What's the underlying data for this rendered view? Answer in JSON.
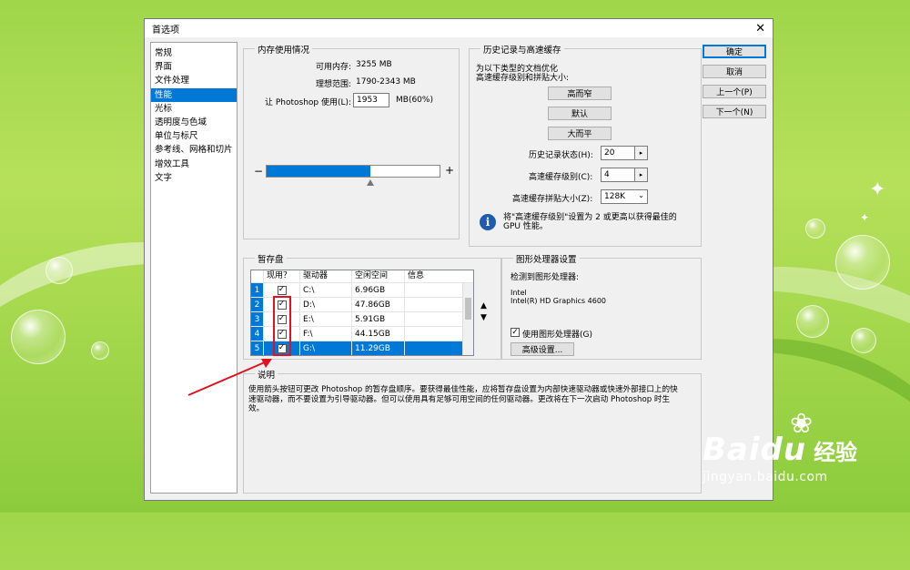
{
  "window": {
    "title": "首选项",
    "close_symbol": "✕"
  },
  "sidebar": {
    "items": [
      {
        "label": "常规"
      },
      {
        "label": "界面"
      },
      {
        "label": "文件处理"
      },
      {
        "label": "性能"
      },
      {
        "label": "光标"
      },
      {
        "label": "透明度与色域"
      },
      {
        "label": "单位与标尺"
      },
      {
        "label": "参考线、网格和切片"
      },
      {
        "label": "增效工具"
      },
      {
        "label": "文字"
      }
    ],
    "selected_index": 3
  },
  "memory": {
    "group_label": "内存使用情况",
    "available_label": "可用内存:",
    "available_value": "3255 MB",
    "ideal_label": "理想范围:",
    "ideal_value": "1790-2343 MB",
    "let_label": "让 Photoshop 使用(L):",
    "let_value": "1953",
    "let_suffix": "MB(60%)",
    "minus": "−",
    "plus": "+",
    "slider_percent": 60
  },
  "history": {
    "group_label": "历史记录与高速缓存",
    "intro_line1": "为以下类型的文档优化",
    "intro_line2": "高速缓存级别和拼贴大小:",
    "btn_tall_thin": "高而窄",
    "btn_default": "默认",
    "btn_big_flat": "大而平",
    "states_label": "历史记录状态(H):",
    "states_value": "20",
    "levels_label": "高速缓存级别(C):",
    "levels_value": "4",
    "tile_label": "高速缓存拼贴大小(Z):",
    "tile_value": "128K",
    "info_text_line1": "将\"高速缓存级别\"设置为 2 或更高以获得最佳的",
    "info_text_line2": "GPU 性能。"
  },
  "scratch": {
    "group_label": "暂存盘",
    "headers": [
      "现用？",
      "驱动器",
      "空闲空间",
      "信息"
    ],
    "rows": [
      {
        "num": "1",
        "drive": "C:\\",
        "space": "6.96GB",
        "info": ""
      },
      {
        "num": "2",
        "drive": "D:\\",
        "space": "47.86GB",
        "info": ""
      },
      {
        "num": "3",
        "drive": "E:\\",
        "space": "5.91GB",
        "info": ""
      },
      {
        "num": "4",
        "drive": "F:\\",
        "space": "44.15GB",
        "info": ""
      },
      {
        "num": "5",
        "drive": "G:\\",
        "space": "11.29GB",
        "info": ""
      }
    ],
    "check": "✓",
    "up_arrow": "▲",
    "down_arrow": "▼"
  },
  "gpu": {
    "group_label": "图形处理器设置",
    "detected_label": "检测到图形处理器:",
    "vendor": "Intel",
    "model": "Intel(R) HD Graphics 4600",
    "use_gpu_label": "使用图形处理器(G)",
    "advanced_button": "高级设置..."
  },
  "description": {
    "group_label": "说明",
    "text": "使用箭头按钮可更改 Photoshop 的暂存盘顺序。要获得最佳性能，应将暂存盘设置为内部快速驱动器或快速外部接口上的快速驱动器，而不要设置为引导驱动器。但可以使用具有足够可用空间的任何驱动器。更改将在下一次启动 Photoshop 时生效。"
  },
  "buttons": {
    "ok": "确定",
    "cancel": "取消",
    "prev": "上一个(P)",
    "next": "下一个(N)"
  },
  "watermark": {
    "brand": "Bai",
    "brand2": "du",
    "cn": "经验",
    "url": "jingyan.baidu.com"
  },
  "colors": {
    "accent": "#0078d7",
    "highlight_red": "#e0121e",
    "background_green": "#a7d94e"
  }
}
